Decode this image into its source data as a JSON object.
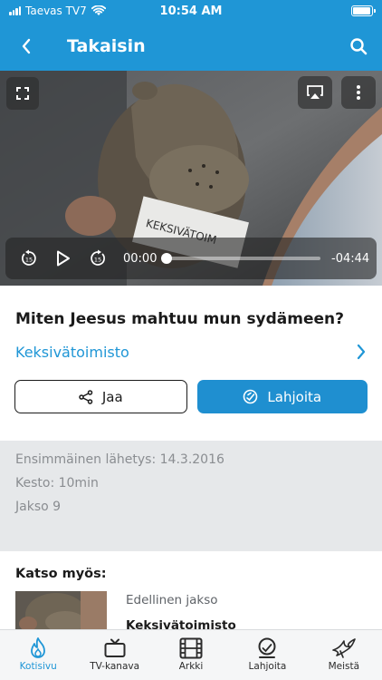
{
  "status_bar": {
    "carrier": "Taevas TV7",
    "time": "10:54 AM",
    "battery_level": 0.95
  },
  "header": {
    "title": "Takaisin"
  },
  "player": {
    "current_time": "00:00",
    "remaining_time": "-04:44",
    "progress": 0,
    "prop_card_text": "KEKSIVÄTOIM"
  },
  "episode": {
    "title": "Miten Jeesus mahtuu mun sydämeen?",
    "series": "Keksivätoimisto"
  },
  "actions": {
    "share_label": "Jaa",
    "donate_label": "Lahjoita"
  },
  "meta": {
    "first_aired": "Ensimmäinen lähetys: 14.3.2016",
    "duration": "Kesto: 10min",
    "episode_no": "Jakso 9"
  },
  "see_also": {
    "title": "Katso myös:",
    "prev_label": "Edellinen jakso",
    "prev_series": "Keksivätoimisto"
  },
  "tabs": [
    {
      "label": "Kotisivu",
      "icon": "flame-icon",
      "active": true
    },
    {
      "label": "TV-kanava",
      "icon": "tv-icon",
      "active": false
    },
    {
      "label": "Arkki",
      "icon": "film-icon",
      "active": false
    },
    {
      "label": "Lahjoita",
      "icon": "donate-icon",
      "active": false
    },
    {
      "label": "Meistä",
      "icon": "dove-icon",
      "active": false
    }
  ],
  "colors": {
    "accent": "#1f96d6",
    "meta_bg": "#e6e8ea"
  }
}
